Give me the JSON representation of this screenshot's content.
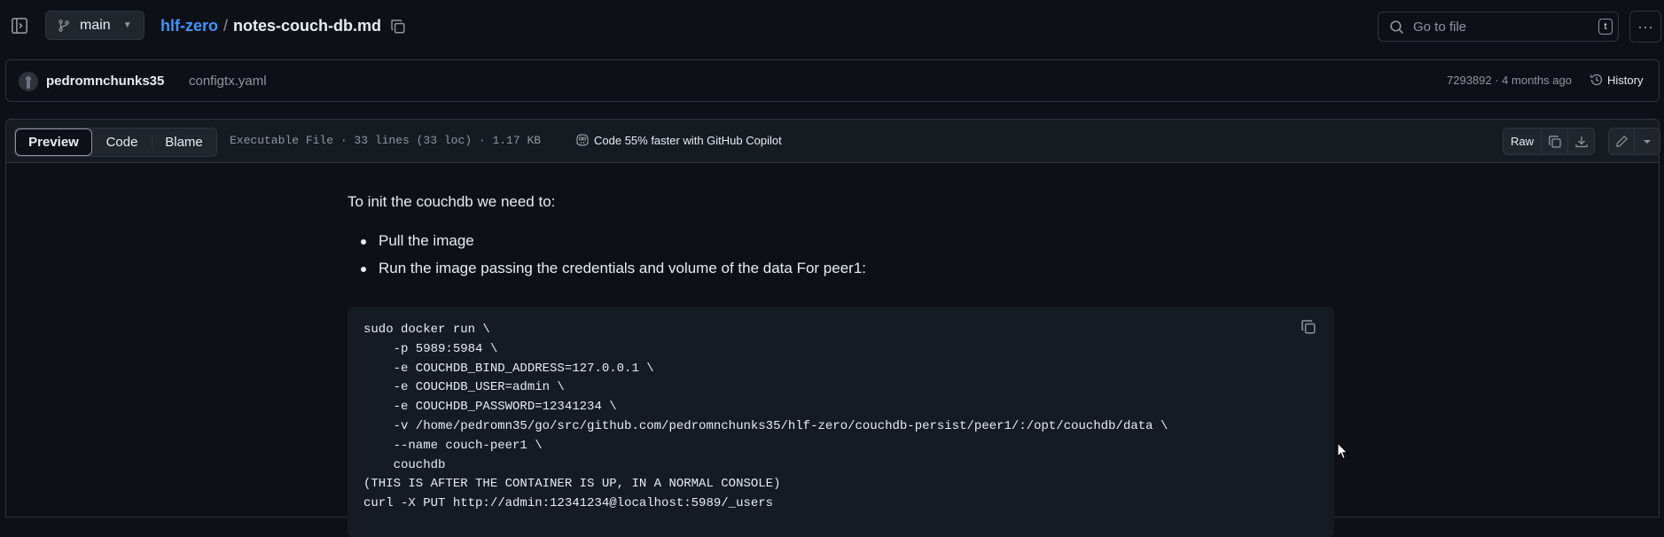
{
  "header": {
    "branch": "main",
    "repo": "hlf-zero",
    "separator": "/",
    "file": "notes-couch-db.md",
    "search_placeholder": "Go to file",
    "search_shortcut": "t",
    "more_label": "···"
  },
  "commit": {
    "author": "pedromnchunks35",
    "message": "configtx.yaml",
    "meta": "7293892 · 4 months ago",
    "history_label": "History"
  },
  "file_header": {
    "tabs": [
      "Preview",
      "Code",
      "Blame"
    ],
    "active_tab": "Preview",
    "info": "Executable File · 33 lines (33 loc) · 1.17 KB",
    "copilot": "Code 55% faster with GitHub Copilot",
    "raw_label": "Raw"
  },
  "content": {
    "intro": "To init the couchdb we need to:",
    "bullets": [
      "Pull the image",
      "Run the image passing the credentials and volume of the data For peer1:"
    ],
    "code": "sudo docker run \\\n    -p 5989:5984 \\\n    -e COUCHDB_BIND_ADDRESS=127.0.0.1 \\\n    -e COUCHDB_USER=admin \\\n    -e COUCHDB_PASSWORD=12341234 \\\n    -v /home/pedromn35/go/src/github.com/pedromnchunks35/hlf-zero/couchdb-persist/peer1/:/opt/couchdb/data \\\n    --name couch-peer1 \\\n    couchdb\n(THIS IS AFTER THE CONTAINER IS UP, IN A NORMAL CONSOLE)\ncurl -X PUT http://admin:12341234@localhost:5989/_users"
  },
  "colors": {
    "background": "#0d1117",
    "link": "#4493f8",
    "muted": "#8d96a0",
    "border": "#30363d"
  }
}
